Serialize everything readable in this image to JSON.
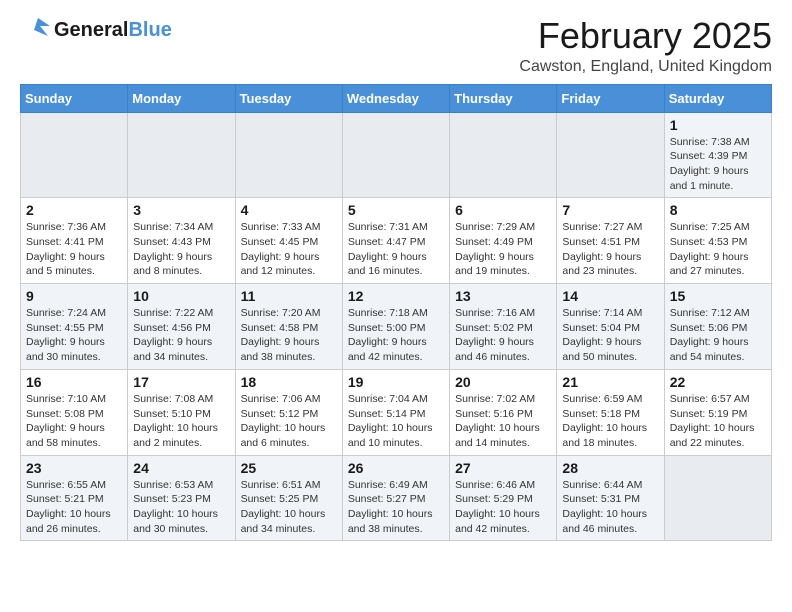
{
  "header": {
    "logo_general": "General",
    "logo_blue": "Blue",
    "month_title": "February 2025",
    "location": "Cawston, England, United Kingdom"
  },
  "days_of_week": [
    "Sunday",
    "Monday",
    "Tuesday",
    "Wednesday",
    "Thursday",
    "Friday",
    "Saturday"
  ],
  "weeks": [
    {
      "days": [
        {
          "num": "",
          "info": "",
          "empty": true
        },
        {
          "num": "",
          "info": "",
          "empty": true
        },
        {
          "num": "",
          "info": "",
          "empty": true
        },
        {
          "num": "",
          "info": "",
          "empty": true
        },
        {
          "num": "",
          "info": "",
          "empty": true
        },
        {
          "num": "",
          "info": "",
          "empty": true
        },
        {
          "num": "1",
          "info": "Sunrise: 7:38 AM\nSunset: 4:39 PM\nDaylight: 9 hours and 1 minute.",
          "empty": false
        }
      ]
    },
    {
      "days": [
        {
          "num": "2",
          "info": "Sunrise: 7:36 AM\nSunset: 4:41 PM\nDaylight: 9 hours and 5 minutes.",
          "empty": false
        },
        {
          "num": "3",
          "info": "Sunrise: 7:34 AM\nSunset: 4:43 PM\nDaylight: 9 hours and 8 minutes.",
          "empty": false
        },
        {
          "num": "4",
          "info": "Sunrise: 7:33 AM\nSunset: 4:45 PM\nDaylight: 9 hours and 12 minutes.",
          "empty": false
        },
        {
          "num": "5",
          "info": "Sunrise: 7:31 AM\nSunset: 4:47 PM\nDaylight: 9 hours and 16 minutes.",
          "empty": false
        },
        {
          "num": "6",
          "info": "Sunrise: 7:29 AM\nSunset: 4:49 PM\nDaylight: 9 hours and 19 minutes.",
          "empty": false
        },
        {
          "num": "7",
          "info": "Sunrise: 7:27 AM\nSunset: 4:51 PM\nDaylight: 9 hours and 23 minutes.",
          "empty": false
        },
        {
          "num": "8",
          "info": "Sunrise: 7:25 AM\nSunset: 4:53 PM\nDaylight: 9 hours and 27 minutes.",
          "empty": false
        }
      ]
    },
    {
      "days": [
        {
          "num": "9",
          "info": "Sunrise: 7:24 AM\nSunset: 4:55 PM\nDaylight: 9 hours and 30 minutes.",
          "empty": false
        },
        {
          "num": "10",
          "info": "Sunrise: 7:22 AM\nSunset: 4:56 PM\nDaylight: 9 hours and 34 minutes.",
          "empty": false
        },
        {
          "num": "11",
          "info": "Sunrise: 7:20 AM\nSunset: 4:58 PM\nDaylight: 9 hours and 38 minutes.",
          "empty": false
        },
        {
          "num": "12",
          "info": "Sunrise: 7:18 AM\nSunset: 5:00 PM\nDaylight: 9 hours and 42 minutes.",
          "empty": false
        },
        {
          "num": "13",
          "info": "Sunrise: 7:16 AM\nSunset: 5:02 PM\nDaylight: 9 hours and 46 minutes.",
          "empty": false
        },
        {
          "num": "14",
          "info": "Sunrise: 7:14 AM\nSunset: 5:04 PM\nDaylight: 9 hours and 50 minutes.",
          "empty": false
        },
        {
          "num": "15",
          "info": "Sunrise: 7:12 AM\nSunset: 5:06 PM\nDaylight: 9 hours and 54 minutes.",
          "empty": false
        }
      ]
    },
    {
      "days": [
        {
          "num": "16",
          "info": "Sunrise: 7:10 AM\nSunset: 5:08 PM\nDaylight: 9 hours and 58 minutes.",
          "empty": false
        },
        {
          "num": "17",
          "info": "Sunrise: 7:08 AM\nSunset: 5:10 PM\nDaylight: 10 hours and 2 minutes.",
          "empty": false
        },
        {
          "num": "18",
          "info": "Sunrise: 7:06 AM\nSunset: 5:12 PM\nDaylight: 10 hours and 6 minutes.",
          "empty": false
        },
        {
          "num": "19",
          "info": "Sunrise: 7:04 AM\nSunset: 5:14 PM\nDaylight: 10 hours and 10 minutes.",
          "empty": false
        },
        {
          "num": "20",
          "info": "Sunrise: 7:02 AM\nSunset: 5:16 PM\nDaylight: 10 hours and 14 minutes.",
          "empty": false
        },
        {
          "num": "21",
          "info": "Sunrise: 6:59 AM\nSunset: 5:18 PM\nDaylight: 10 hours and 18 minutes.",
          "empty": false
        },
        {
          "num": "22",
          "info": "Sunrise: 6:57 AM\nSunset: 5:19 PM\nDaylight: 10 hours and 22 minutes.",
          "empty": false
        }
      ]
    },
    {
      "days": [
        {
          "num": "23",
          "info": "Sunrise: 6:55 AM\nSunset: 5:21 PM\nDaylight: 10 hours and 26 minutes.",
          "empty": false
        },
        {
          "num": "24",
          "info": "Sunrise: 6:53 AM\nSunset: 5:23 PM\nDaylight: 10 hours and 30 minutes.",
          "empty": false
        },
        {
          "num": "25",
          "info": "Sunrise: 6:51 AM\nSunset: 5:25 PM\nDaylight: 10 hours and 34 minutes.",
          "empty": false
        },
        {
          "num": "26",
          "info": "Sunrise: 6:49 AM\nSunset: 5:27 PM\nDaylight: 10 hours and 38 minutes.",
          "empty": false
        },
        {
          "num": "27",
          "info": "Sunrise: 6:46 AM\nSunset: 5:29 PM\nDaylight: 10 hours and 42 minutes.",
          "empty": false
        },
        {
          "num": "28",
          "info": "Sunrise: 6:44 AM\nSunset: 5:31 PM\nDaylight: 10 hours and 46 minutes.",
          "empty": false
        },
        {
          "num": "",
          "info": "",
          "empty": true
        }
      ]
    }
  ]
}
